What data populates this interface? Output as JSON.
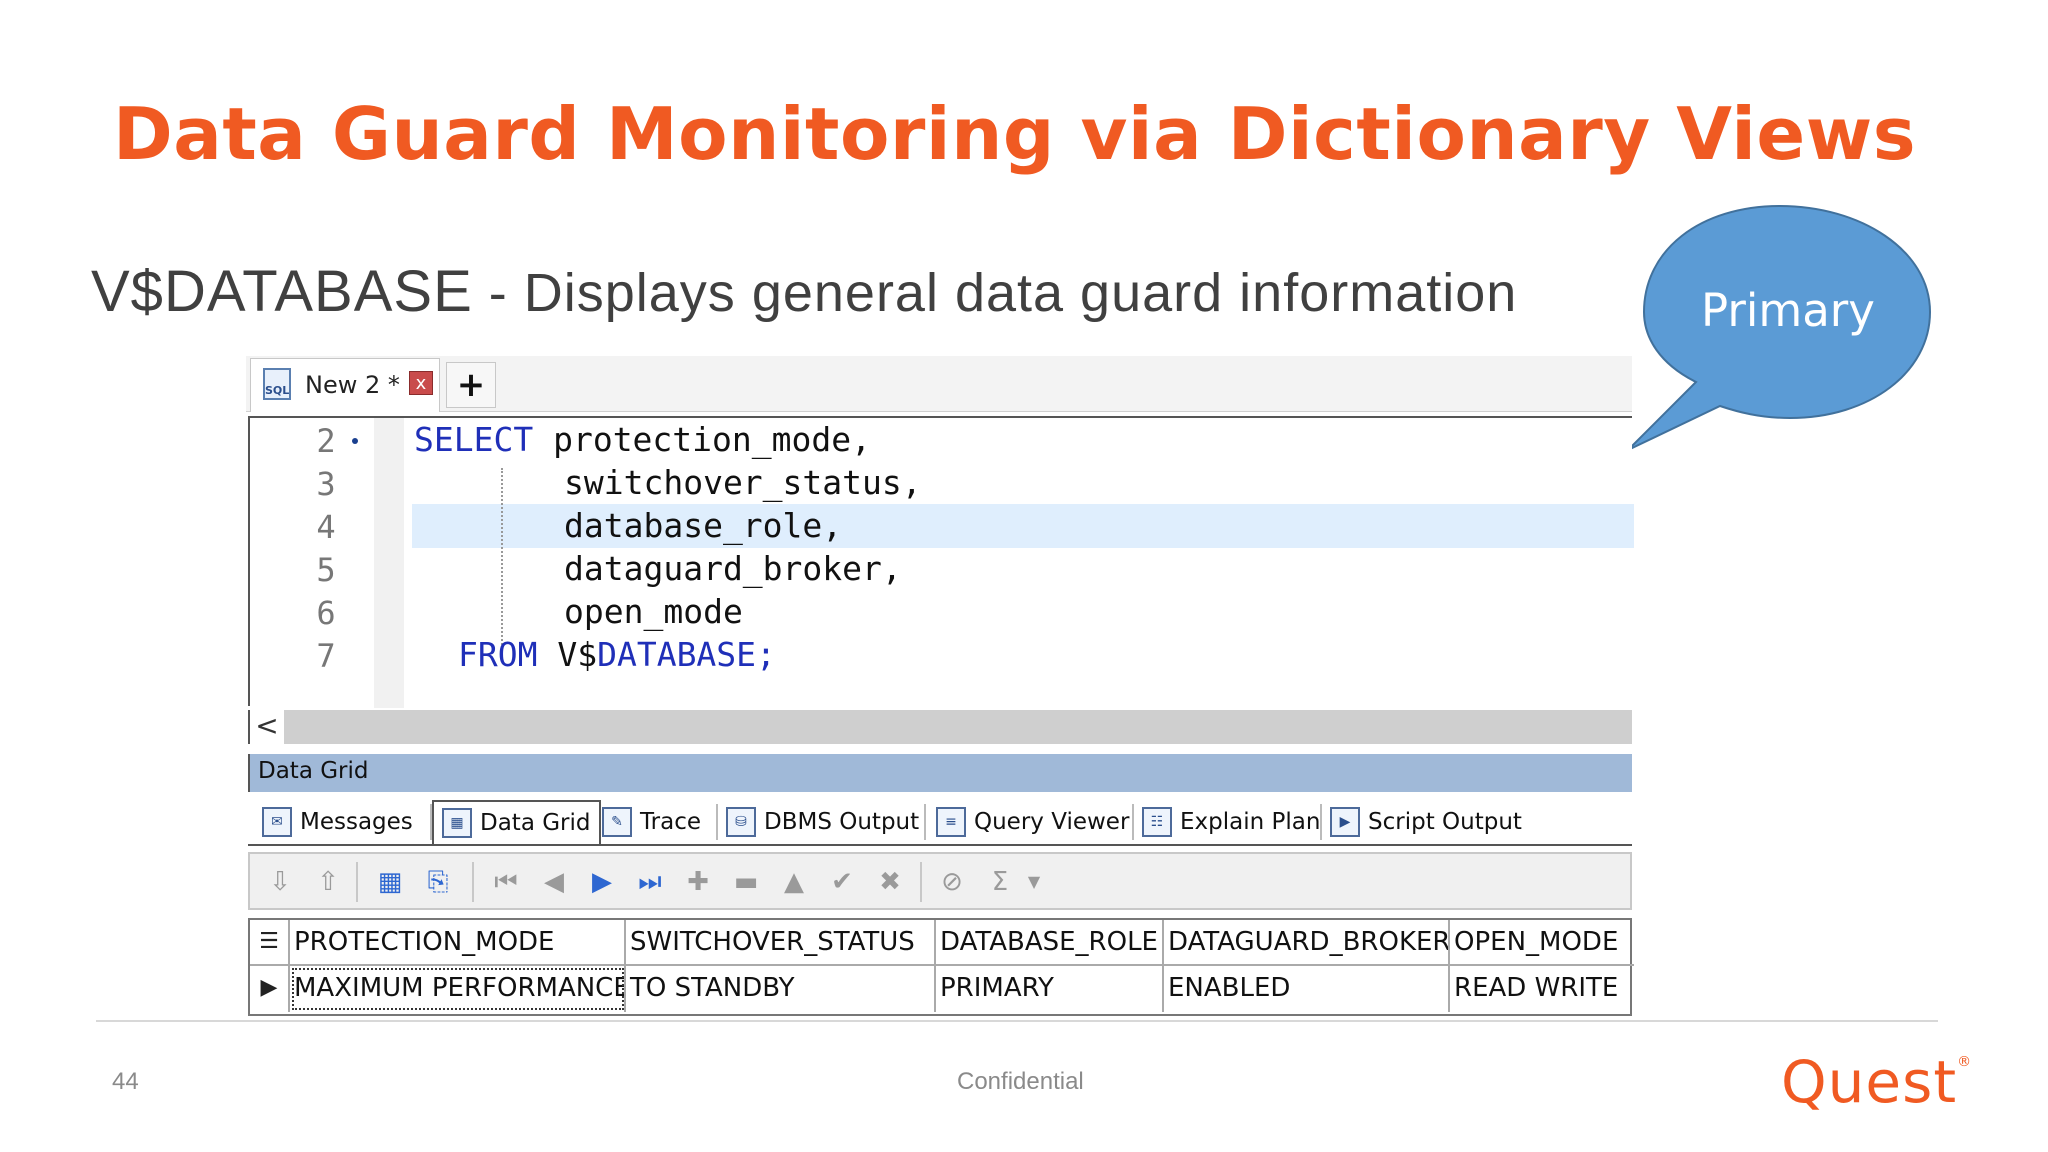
{
  "slide": {
    "title": "Data Guard Monitoring via Dictionary Views",
    "subtitle_view": "V$DATABASE",
    "subtitle_rest": " - Displays general data guard information",
    "bubble_text": "Primary",
    "bubble_color": "#5b9bd5",
    "accent_color": "#f05a22",
    "page_number": "44",
    "footer_text": "Confidential",
    "logo_text": "Quest"
  },
  "ide": {
    "doc_tab": {
      "icon": "SQL",
      "label": "New 2 *",
      "close": "x"
    },
    "add_tab": "+",
    "editor": {
      "line_numbers": [
        "2",
        "3",
        "4",
        "5",
        "6",
        "7"
      ],
      "lines": [
        {
          "keyword": "SELECT",
          "text": " protection_mode,"
        },
        {
          "keyword": "",
          "text": "switchover_status,"
        },
        {
          "keyword": "",
          "text": "database_role,"
        },
        {
          "keyword": "",
          "text": "dataguard_broker,"
        },
        {
          "keyword": "",
          "text": "open_mode"
        },
        {
          "keyword": "FROM",
          "text": " V$",
          "keyword2": "DATABASE;"
        }
      ],
      "highlighted_line": "4"
    },
    "scroll_left": "<",
    "panel_title": "Data Grid",
    "result_tabs": [
      {
        "label": "Messages",
        "icon": "messages-icon"
      },
      {
        "label": "Data Grid",
        "icon": "data-grid-icon",
        "active": true
      },
      {
        "label": "Trace",
        "icon": "trace-icon"
      },
      {
        "label": "DBMS Output",
        "icon": "dbms-output-icon"
      },
      {
        "label": "Query Viewer",
        "icon": "query-viewer-icon"
      },
      {
        "label": "Explain Plan",
        "icon": "explain-plan-icon"
      },
      {
        "label": "Script Output",
        "icon": "script-output-icon"
      }
    ],
    "grid": {
      "columns": [
        "PROTECTION_MODE",
        "SWITCHOVER_STATUS",
        "DATABASE_ROLE",
        "DATAGUARD_BROKER",
        "OPEN_MODE"
      ],
      "rows": [
        [
          "MAXIMUM PERFORMANCE",
          "TO STANDBY",
          "PRIMARY",
          "ENABLED",
          "READ WRITE"
        ]
      ]
    }
  }
}
